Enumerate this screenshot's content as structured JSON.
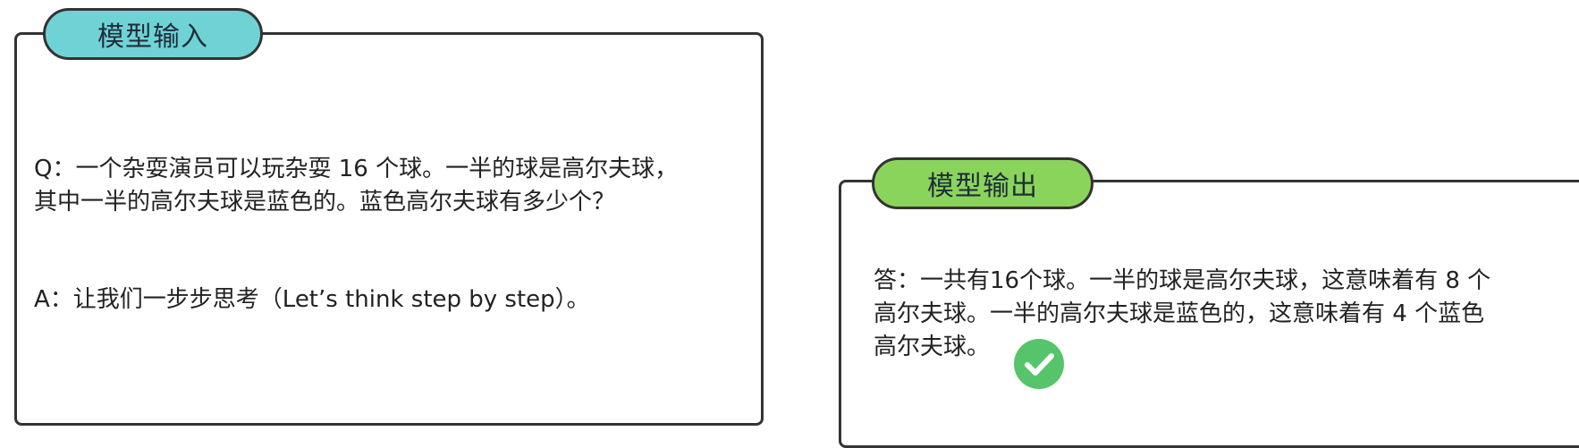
{
  "input_panel": {
    "tag": "模型输入",
    "question_lines": [
      "Q：一个杂耍演员可以玩杂耍 16 个球。一半的球是高尔夫球，",
      "其中一半的高尔夫球是蓝色的。蓝色高尔夫球有多少个？"
    ],
    "answer_prompt": "A：让我们一步步思考（Let’s think step by step）。"
  },
  "output_panel": {
    "tag": "模型输出",
    "answer_lines": [
      "答：一共有16个球。一半的球是高尔夫球，这意味着有 8 个",
      "高尔夫球。一半的高尔夫球是蓝色的，这意味着有 4 个蓝色",
      "高尔夫球。"
    ],
    "check_icon": "check-circle-icon",
    "check_color": "#56c46a"
  },
  "colors": {
    "input_tag": "#6fd3d6",
    "output_tag": "#8bd45c",
    "border": "#333333"
  }
}
